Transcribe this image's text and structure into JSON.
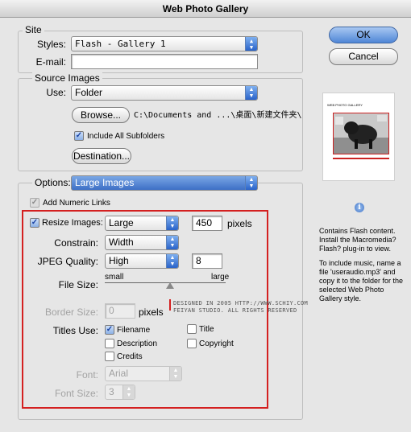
{
  "window": {
    "title": "Web Photo Gallery"
  },
  "site": {
    "group_label": "Site",
    "styles_label": "Styles:",
    "styles_value": "Flash - Gallery 1",
    "email_label": "E-mail:",
    "email_value": ""
  },
  "source": {
    "group_label": "Source Images",
    "use_label": "Use:",
    "use_value": "Folder",
    "browse_label": "Browse...",
    "path": "C:\\Documents and ...\\桌面\\新建文件夹\\",
    "include_subfolders_label": "Include All Subfolders",
    "include_subfolders_checked": true,
    "destination_label": "Destination..."
  },
  "options": {
    "label": "Options:",
    "value": "Large Images",
    "add_numeric_links_label": "Add Numeric Links",
    "add_numeric_links_checked": true,
    "resize_images_label": "Resize Images:",
    "resize_images_checked": true,
    "resize_size": "Large",
    "resize_pixels": "450",
    "pixels_label": "pixels",
    "constrain_label": "Constrain:",
    "constrain_value": "Width",
    "jpeg_quality_label": "JPEG Quality:",
    "jpeg_quality_value": "High",
    "jpeg_quality_number": "8",
    "file_size_label": "File Size:",
    "file_size_small": "small",
    "file_size_large": "large",
    "file_size_level": 0.54,
    "border_size_label": "Border Size:",
    "border_size_value": "0",
    "border_pixels_label": "pixels",
    "titles_use_label": "Titles Use:",
    "filename_label": "Filename",
    "filename_checked": true,
    "title_label": "Title",
    "title_checked": false,
    "description_label": "Description",
    "description_checked": false,
    "copyright_label": "Copyright",
    "copyright_checked": false,
    "credits_label": "Credits",
    "credits_checked": false,
    "font_label": "Font:",
    "font_value": "Arial",
    "font_size_label": "Font Size:",
    "font_size_value": "3"
  },
  "watermark": {
    "line1": "DESIGNED IN 2005 HTTP://WWW.SCHIY.COM",
    "line2": "FEIYAN STUDIO. ALL RIGHTS RESERVED"
  },
  "buttons": {
    "ok": "OK",
    "cancel": "Cancel"
  },
  "preview": {
    "thumb_title": "WEB PHOTO GALLERY"
  },
  "info": {
    "icon": "info-icon",
    "text1": "Contains Flash content. Install the Macromedia? Flash? plug-in to view.",
    "text2": "To include music, name a file 'useraudio.mp3' and copy it to the folder for the selected Web Photo Gallery style."
  },
  "colors": {
    "accent": "#3d6fc6",
    "highlight_box": "#d42020"
  }
}
